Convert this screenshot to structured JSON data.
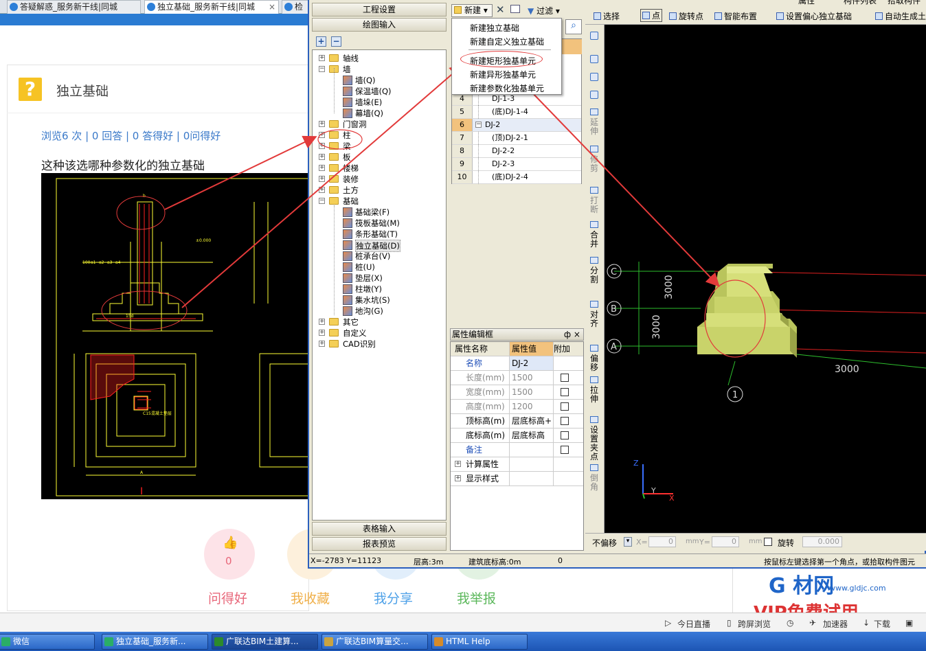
{
  "browser": {
    "tabs": [
      {
        "label": "答疑解惑_服务新干线|同城"
      },
      {
        "label": "独立基础_服务新干线|同城"
      },
      {
        "label": "检"
      }
    ],
    "question": {
      "title": "独立基础",
      "stats": "浏览6 次 | 0 回答 | 0 答得好 | 0问得好",
      "text": "这种该选哪种参数化的独立基础"
    },
    "actions": [
      {
        "label": "问得好",
        "count": "0",
        "color": "#e8677a"
      },
      {
        "label": "我收藏",
        "color": "#f0b04a"
      },
      {
        "label": "我分享",
        "color": "#4ea1e8"
      },
      {
        "label": "我举报",
        "color": "#5cb85c"
      }
    ],
    "ad": {
      "brand": "G 材网",
      "url": "www.gldjc.com",
      "promo": "VIP免费试用"
    },
    "status_items": [
      "今日直播",
      "跨屏浏览",
      "加速器",
      "下载"
    ]
  },
  "cad_labels": {
    "fill": "C15混凝土垫层",
    "dims": [
      "100",
      "a1",
      "a2",
      "a3",
      "a4",
      "b",
      "15d",
      "±0.000",
      "A"
    ]
  },
  "app": {
    "left_headers": {
      "settings": "工程设置",
      "drawing": "绘图输入",
      "table_input": "表格输入",
      "report": "报表预览"
    },
    "tree": [
      {
        "label": "轴线",
        "type": "folder",
        "plus": "+"
      },
      {
        "label": "墙",
        "type": "folder",
        "plus": "−"
      },
      {
        "label": "墙(Q)",
        "type": "leaf"
      },
      {
        "label": "保温墙(Q)",
        "type": "leaf"
      },
      {
        "label": "墙垛(E)",
        "type": "leaf"
      },
      {
        "label": "幕墙(Q)",
        "type": "leaf"
      },
      {
        "label": "门窗洞",
        "type": "folder",
        "plus": "+"
      },
      {
        "label": "柱",
        "type": "folder",
        "plus": "+"
      },
      {
        "label": "梁",
        "type": "folder",
        "plus": "+"
      },
      {
        "label": "板",
        "type": "folder",
        "plus": "+"
      },
      {
        "label": "楼梯",
        "type": "folder",
        "plus": "+"
      },
      {
        "label": "装修",
        "type": "folder",
        "plus": "+"
      },
      {
        "label": "土方",
        "type": "folder",
        "plus": "+"
      },
      {
        "label": "基础",
        "type": "folder",
        "plus": "−"
      },
      {
        "label": "基础梁(F)",
        "type": "leaf"
      },
      {
        "label": "筏板基础(M)",
        "type": "leaf"
      },
      {
        "label": "条形基础(T)",
        "type": "leaf"
      },
      {
        "label": "独立基础(D)",
        "type": "leaf",
        "selected": true
      },
      {
        "label": "桩承台(V)",
        "type": "leaf"
      },
      {
        "label": "桩(U)",
        "type": "leaf"
      },
      {
        "label": "垫层(X)",
        "type": "leaf"
      },
      {
        "label": "柱墩(Y)",
        "type": "leaf"
      },
      {
        "label": "集水坑(S)",
        "type": "leaf"
      },
      {
        "label": "地沟(G)",
        "type": "leaf"
      },
      {
        "label": "其它",
        "type": "folder",
        "plus": "+"
      },
      {
        "label": "自定义",
        "type": "folder",
        "plus": "+"
      },
      {
        "label": "CAD识别",
        "type": "folder",
        "plus": "+"
      }
    ],
    "mid_toolbar": {
      "new": "新建",
      "filter": "过滤"
    },
    "new_menu": [
      "新建独立基础",
      "新建自定义独立基础",
      "新建矩形独基单元",
      "新建异形独基单元",
      "新建参数化独基单元"
    ],
    "grid_rows": [
      {
        "no": "4",
        "name": "DJ-1-3"
      },
      {
        "no": "5",
        "name": "(底)DJ-1-4"
      },
      {
        "no": "6",
        "name": "DJ-2",
        "group": true
      },
      {
        "no": "7",
        "name": "(顶)DJ-2-1"
      },
      {
        "no": "8",
        "name": "DJ-2-2"
      },
      {
        "no": "9",
        "name": "DJ-2-3"
      },
      {
        "no": "10",
        "name": "(底)DJ-2-4"
      }
    ],
    "prop_editor": {
      "title": "属性编辑框",
      "pin": "ф ×",
      "headers": [
        "属性名称",
        "属性值",
        "附加"
      ],
      "rows": [
        {
          "name": "名称",
          "value": "DJ-2",
          "blue": true
        },
        {
          "name": "长度(mm)",
          "value": "1500",
          "grey": true,
          "check": true
        },
        {
          "name": "宽度(mm)",
          "value": "1500",
          "grey": true,
          "check": true
        },
        {
          "name": "高度(mm)",
          "value": "1200",
          "grey": true,
          "check": true
        },
        {
          "name": "顶标高(m)",
          "value": "层底标高+",
          "check": true
        },
        {
          "name": "底标高(m)",
          "value": "层底标高",
          "check": true
        },
        {
          "name": "备注",
          "value": "",
          "blue": true,
          "check": true
        },
        {
          "name": "计算属性",
          "value": "",
          "expand": true
        },
        {
          "name": "显示样式",
          "value": "",
          "expand": true
        }
      ]
    },
    "top_toolbar": [
      "选择",
      "点",
      "旋转点",
      "智能布置",
      "设置偏心独立基础",
      "自动生成土"
    ],
    "top_partial": [
      "属性",
      "构件列表",
      "拾取构件"
    ],
    "vtools": [
      "延伸",
      "修剪",
      "打断",
      "合并",
      "分割",
      "对齐",
      "偏移",
      "拉伸",
      "设置夹点",
      "倒角"
    ],
    "viewport": {
      "axes": [
        "C",
        "B",
        "A",
        "1"
      ],
      "dims": [
        "3000",
        "3000",
        "3000"
      ],
      "axis_x": "Y",
      "axis_y": "Z",
      "x_label": "X"
    },
    "bottom_bar": {
      "mode": "不偏移",
      "x": "X=",
      "y": "Y=",
      "x_val": "0",
      "y_val": "0",
      "unit": "mm",
      "rotate": "旋转",
      "rot_val": "0.000"
    },
    "status": {
      "coords": "X=-2783 Y=11123",
      "floor_h": "层高:3m",
      "base": "建筑底标高:0m",
      "zero": "0",
      "hint": "按鼠标左键选择第一个角点，或拾取构件图元"
    }
  },
  "taskbar": [
    {
      "label": "微信",
      "color": "#2aae67"
    },
    {
      "label": "独立基础_服务新...",
      "color": "#2aae67"
    },
    {
      "label": "广联达BIM土建算...",
      "color": "#2c8a2c"
    },
    {
      "label": "广联达BIM算量交...",
      "color": "#c9a340"
    },
    {
      "label": "HTML Help",
      "color": "#d68b2a"
    }
  ],
  "colors": {
    "annot": "#e23a3a",
    "cad_yellow": "#ffff33",
    "cad_red": "#ff2020",
    "block": "#c8d36a"
  }
}
